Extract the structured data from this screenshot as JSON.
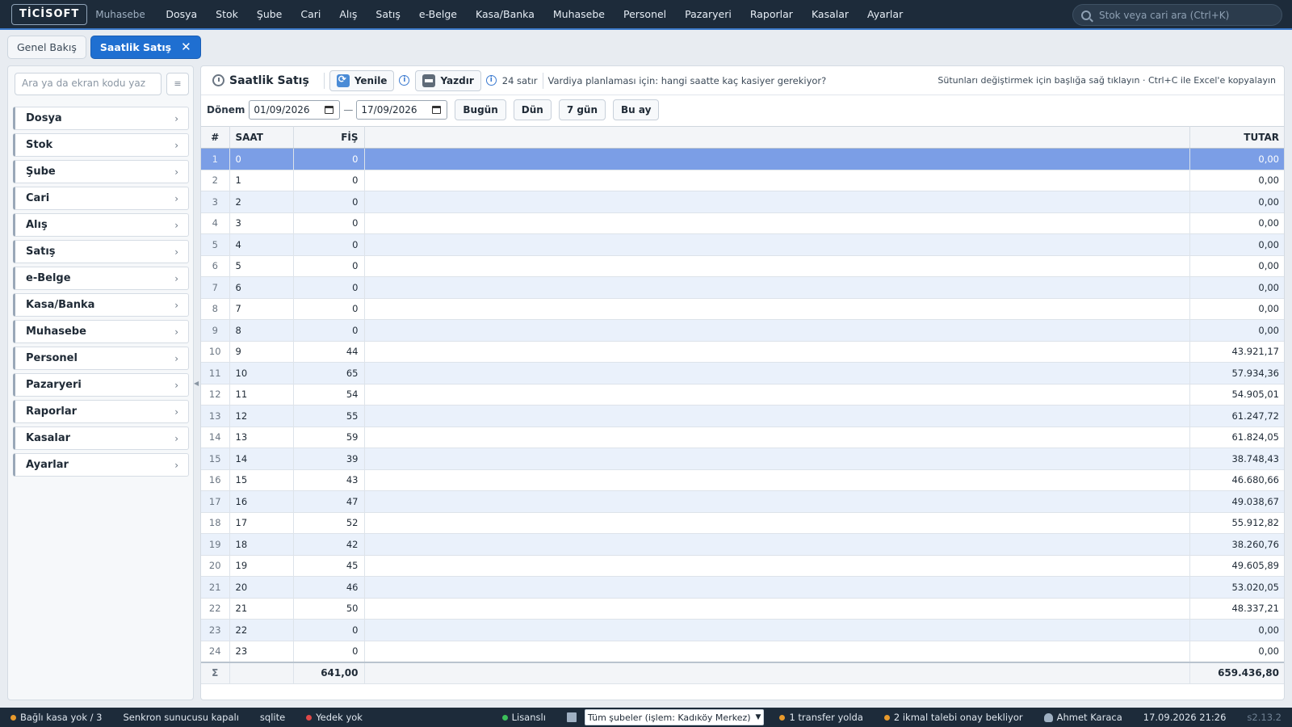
{
  "topbar": {
    "logo": "TİCİSOFT",
    "subtitle": "Muhasebe",
    "menu": [
      "Dosya",
      "Stok",
      "Şube",
      "Cari",
      "Alış",
      "Satış",
      "e-Belge",
      "Kasa/Banka",
      "Muhasebe",
      "Personel",
      "Pazaryeri",
      "Raporlar",
      "Kasalar",
      "Ayarlar"
    ],
    "search_placeholder": "Stok veya cari ara (Ctrl+K)"
  },
  "tabs": [
    {
      "label": "Genel Bakış",
      "active": false
    },
    {
      "label": "Saatlik Satış",
      "active": true,
      "close": "✕"
    }
  ],
  "sidebar": {
    "search_placeholder": "Ara ya da ekran kodu yaz",
    "menu_icon": "≡",
    "items": [
      "Dosya",
      "Stok",
      "Şube",
      "Cari",
      "Alış",
      "Satış",
      "e-Belge",
      "Kasa/Banka",
      "Muhasebe",
      "Personel",
      "Pazaryeri",
      "Raporlar",
      "Kasalar",
      "Ayarlar"
    ],
    "chevron": "›"
  },
  "toolbar": {
    "title": "Saatlik Satış",
    "refresh_label": "Yenile",
    "print_label": "Yazdır",
    "row_count": "24 satır",
    "question": "Vardiya planlaması için: hangi saatte kaç kasiyer gerekiyor?",
    "hint": "Sütunları değiştirmek için başlığa sağ tıklayın · Ctrl+C ile Excel'e kopyalayın",
    "info": "i"
  },
  "filters": {
    "label": "Dönem",
    "date_from": "01/09/2026",
    "date_to": "17/09/2026",
    "dash": "—",
    "buttons": [
      "Bugün",
      "Dün",
      "7 gün",
      "Bu ay"
    ]
  },
  "table": {
    "headers": {
      "idx": "#",
      "saat": "SAAT",
      "fis": "FİŞ",
      "tutar": "TUTAR"
    },
    "rows": [
      {
        "idx": "1",
        "saat": "0",
        "fis": "0",
        "tutar": "0,00"
      },
      {
        "idx": "2",
        "saat": "1",
        "fis": "0",
        "tutar": "0,00"
      },
      {
        "idx": "3",
        "saat": "2",
        "fis": "0",
        "tutar": "0,00"
      },
      {
        "idx": "4",
        "saat": "3",
        "fis": "0",
        "tutar": "0,00"
      },
      {
        "idx": "5",
        "saat": "4",
        "fis": "0",
        "tutar": "0,00"
      },
      {
        "idx": "6",
        "saat": "5",
        "fis": "0",
        "tutar": "0,00"
      },
      {
        "idx": "7",
        "saat": "6",
        "fis": "0",
        "tutar": "0,00"
      },
      {
        "idx": "8",
        "saat": "7",
        "fis": "0",
        "tutar": "0,00"
      },
      {
        "idx": "9",
        "saat": "8",
        "fis": "0",
        "tutar": "0,00"
      },
      {
        "idx": "10",
        "saat": "9",
        "fis": "44",
        "tutar": "43.921,17"
      },
      {
        "idx": "11",
        "saat": "10",
        "fis": "65",
        "tutar": "57.934,36"
      },
      {
        "idx": "12",
        "saat": "11",
        "fis": "54",
        "tutar": "54.905,01"
      },
      {
        "idx": "13",
        "saat": "12",
        "fis": "55",
        "tutar": "61.247,72"
      },
      {
        "idx": "14",
        "saat": "13",
        "fis": "59",
        "tutar": "61.824,05"
      },
      {
        "idx": "15",
        "saat": "14",
        "fis": "39",
        "tutar": "38.748,43"
      },
      {
        "idx": "16",
        "saat": "15",
        "fis": "43",
        "tutar": "46.680,66"
      },
      {
        "idx": "17",
        "saat": "16",
        "fis": "47",
        "tutar": "49.038,67"
      },
      {
        "idx": "18",
        "saat": "17",
        "fis": "52",
        "tutar": "55.912,82"
      },
      {
        "idx": "19",
        "saat": "18",
        "fis": "42",
        "tutar": "38.260,76"
      },
      {
        "idx": "20",
        "saat": "19",
        "fis": "45",
        "tutar": "49.605,89"
      },
      {
        "idx": "21",
        "saat": "20",
        "fis": "46",
        "tutar": "53.020,05"
      },
      {
        "idx": "22",
        "saat": "21",
        "fis": "50",
        "tutar": "48.337,21"
      },
      {
        "idx": "23",
        "saat": "22",
        "fis": "0",
        "tutar": "0,00"
      },
      {
        "idx": "24",
        "saat": "23",
        "fis": "0",
        "tutar": "0,00"
      }
    ],
    "selected_row": 1,
    "totals": {
      "sigma": "Σ",
      "fis": "641,00",
      "tutar": "659.436,80"
    }
  },
  "statusbar": {
    "kasa": "Bağlı kasa yok / 3",
    "sync": "Senkron sunucusu kapalı",
    "db": "sqlite",
    "backup": "Yedek yok",
    "license": "Lisanslı",
    "branch_select": "Tüm şubeler (işlem: Kadıköy Merkez)",
    "transfer": "1 transfer yolda",
    "ikmal": "2 ikmal talebi onay bekliyor",
    "user": "Ahmet Karaca",
    "datetime": "17.09.2026 21:26",
    "version": "s2.13.2"
  },
  "colors": {
    "accent": "#1f6fd1",
    "topbar": "#1d2b3a",
    "selected_row": "#7b9ee6",
    "warn_dot": "#e89a2c",
    "error_dot": "#e04848",
    "ok_dot": "#3cbf5a"
  }
}
